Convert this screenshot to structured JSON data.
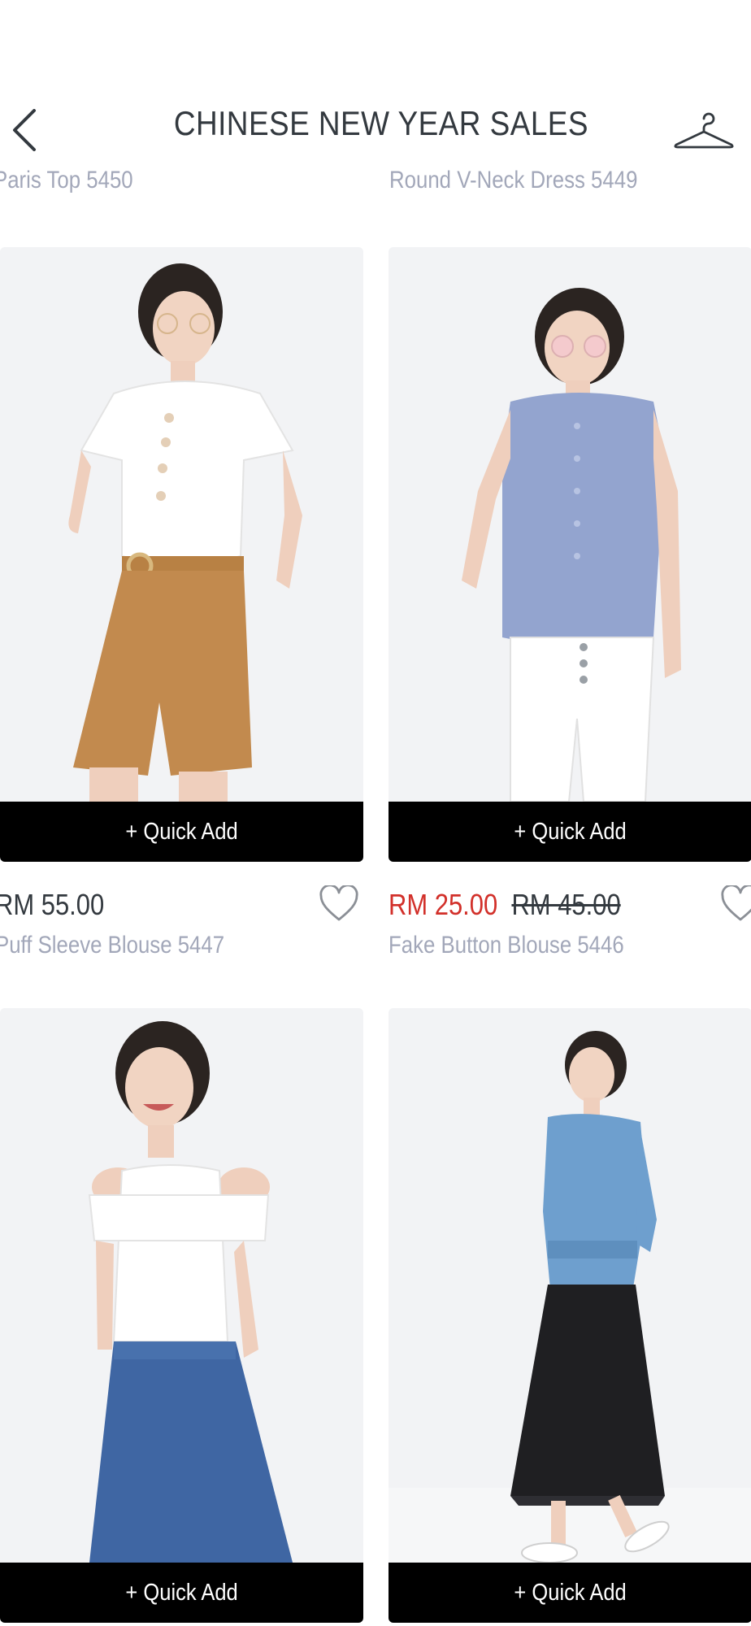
{
  "header": {
    "title": "CHINESE NEW YEAR SALES",
    "back_icon": "chevron-left-icon",
    "wardrobe_icon": "hanger-icon"
  },
  "top_names": [
    "Paris Top 5450",
    "Round V-Neck Dress 5449"
  ],
  "quick_add_label": "+ Quick Add",
  "products": [
    {
      "price": "RM 55.00",
      "original_price": "",
      "name": "Puff Sleeve Blouse 5447",
      "on_sale": false
    },
    {
      "price": "RM 25.00",
      "original_price": "RM 45.00",
      "name": "Fake Button Blouse 5446",
      "on_sale": true
    },
    {
      "price": "",
      "original_price": "",
      "name": "",
      "on_sale": false
    },
    {
      "price": "",
      "original_price": "",
      "name": "",
      "on_sale": false
    }
  ],
  "colors": {
    "sale_price": "#d2302a",
    "muted_text": "#a2a7b9",
    "button_bg": "#000000"
  }
}
